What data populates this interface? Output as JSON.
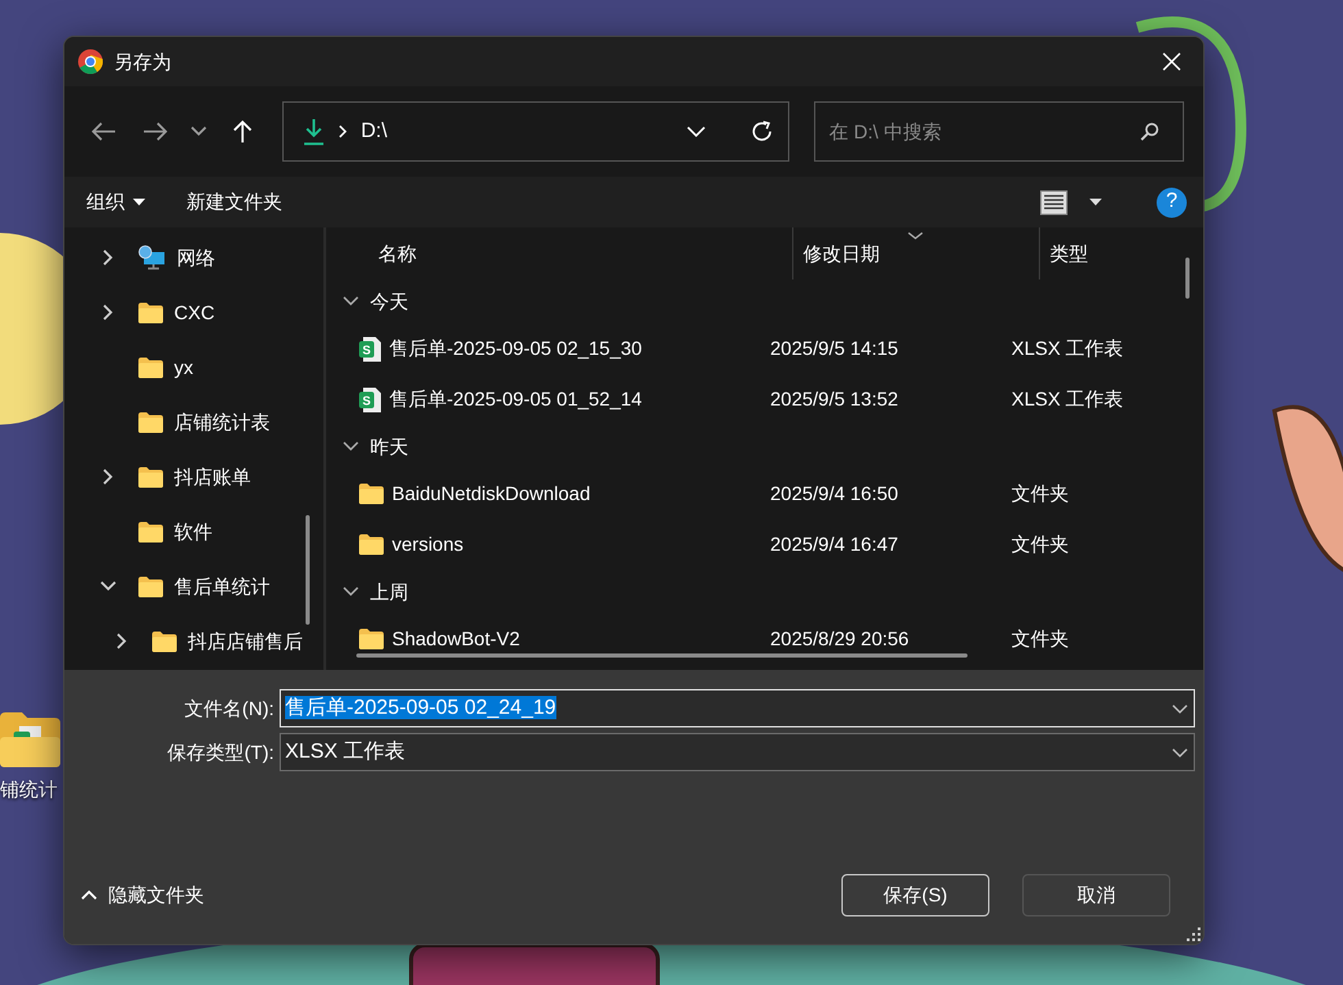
{
  "desktop": {
    "icon_label": "铺统计"
  },
  "window": {
    "title": "另存为"
  },
  "navigation": {
    "address": "D:\\",
    "search": {
      "placeholder": "在 D:\\ 中搜索"
    }
  },
  "command_bar": {
    "organize": "组织",
    "new_folder": "新建文件夹",
    "help": "?"
  },
  "sidebar": {
    "items": [
      {
        "label": "网络",
        "kind": "network",
        "expandable": true,
        "expanded": false
      },
      {
        "label": "CXC",
        "kind": "folder",
        "expandable": true,
        "expanded": false
      },
      {
        "label": "yx",
        "kind": "folder",
        "expandable": false
      },
      {
        "label": "店铺统计表",
        "kind": "folder",
        "expandable": false
      },
      {
        "label": "抖店账单",
        "kind": "folder",
        "expandable": true,
        "expanded": false
      },
      {
        "label": "软件",
        "kind": "folder",
        "expandable": false
      },
      {
        "label": "售后单统计",
        "kind": "folder",
        "expandable": true,
        "expanded": true,
        "children": [
          {
            "label": "抖店店铺售后",
            "kind": "folder",
            "expandable": true,
            "expanded": false
          }
        ]
      }
    ]
  },
  "file_list": {
    "columns": [
      "名称",
      "修改日期",
      "类型"
    ],
    "groups": [
      {
        "label": "今天",
        "expanded": true,
        "rows": [
          {
            "name": "售后单-2025-09-05 02_15_30",
            "kind": "sheet",
            "icon_text": "S",
            "modified": "2025/9/5 14:15",
            "type": "XLSX 工作表"
          },
          {
            "name": "售后单-2025-09-05 01_52_14",
            "kind": "sheet",
            "icon_text": "S",
            "modified": "2025/9/5 13:52",
            "type": "XLSX 工作表"
          }
        ]
      },
      {
        "label": "昨天",
        "expanded": true,
        "rows": [
          {
            "name": "BaiduNetdiskDownload",
            "kind": "folder",
            "modified": "2025/9/4 16:50",
            "type": "文件夹"
          },
          {
            "name": "versions",
            "kind": "folder",
            "modified": "2025/9/4 16:47",
            "type": "文件夹"
          }
        ]
      },
      {
        "label": "上周",
        "expanded": true,
        "rows": [
          {
            "name": "ShadowBot-V2",
            "kind": "folder",
            "modified": "2025/8/29 20:56",
            "type": "文件夹"
          }
        ]
      }
    ]
  },
  "form": {
    "file_name": {
      "label": "文件名(N):",
      "value": "售后单-2025-09-05 02_24_19",
      "text_selected": true
    },
    "save_type": {
      "label": "保存类型(T):",
      "value": "XLSX 工作表"
    }
  },
  "footer": {
    "hide_folders": "隐藏文件夹",
    "buttons": [
      {
        "label": "保存(S)",
        "kind": "primary"
      },
      {
        "label": "取消",
        "kind": "secondary"
      }
    ]
  }
}
